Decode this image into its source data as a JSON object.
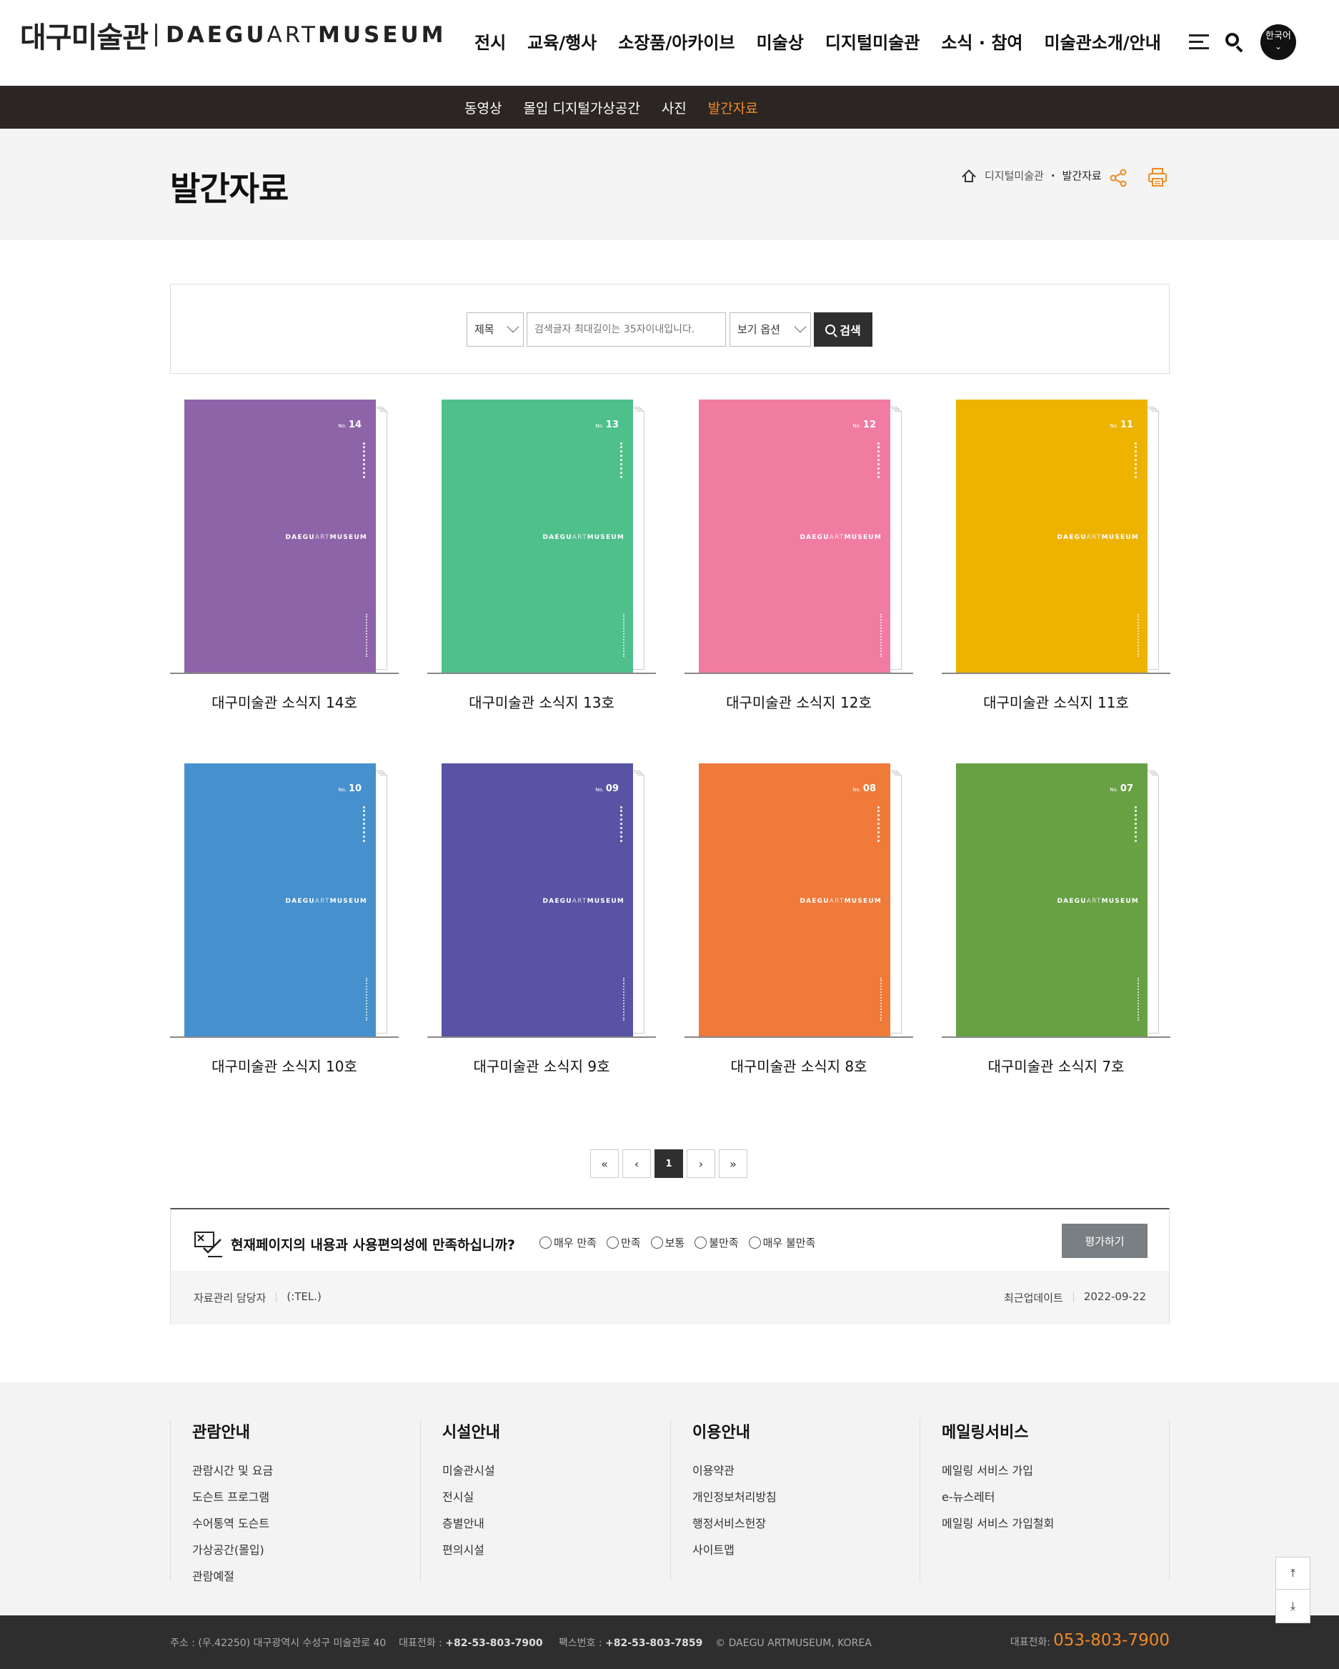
{
  "header": {
    "logo_kr": "대구미술관",
    "logo_en_a": "DAEGU",
    "logo_en_b": "ART",
    "logo_en_c": "MUSEUM",
    "nav": [
      "전시",
      "교육/행사",
      "소장품/아카이브",
      "미술상",
      "디지털미술관",
      "소식 · 참여",
      "미술관소개/안내"
    ],
    "lang": "한국어"
  },
  "subnav": {
    "items": [
      "동영상",
      "몰입 디지털가상공간",
      "사진",
      "발간자료"
    ],
    "active_index": 3,
    "active_color": "#f08a24"
  },
  "page": {
    "title": "발간자료",
    "breadcrumb": [
      "디지털미술관",
      "발간자료"
    ]
  },
  "search": {
    "field_select": "제목",
    "placeholder": "검색글자 최대길이는 35자이내입니다.",
    "view_select": "보기 옵션",
    "button": "검색"
  },
  "books": [
    {
      "title": "대구미술관 소식지 14호",
      "no": "14",
      "color": "#8e64a8"
    },
    {
      "title": "대구미술관 소식지 13호",
      "no": "13",
      "color": "#4fbf8c"
    },
    {
      "title": "대구미술관 소식지 12호",
      "no": "12",
      "color": "#f17ca2"
    },
    {
      "title": "대구미술관 소식지 11호",
      "no": "11",
      "color": "#eeb200"
    },
    {
      "title": "대구미술관 소식지 10호",
      "no": "10",
      "color": "#4590cd"
    },
    {
      "title": "대구미술관 소식지 9호",
      "no": "09",
      "color": "#5853a4"
    },
    {
      "title": "대구미술관 소식지 8호",
      "no": "08",
      "color": "#ef7a3a"
    },
    {
      "title": "대구미술관 소식지 7호",
      "no": "07",
      "color": "#67a143"
    }
  ],
  "book_brand": {
    "a": "DAEGU",
    "b": "ART",
    "c": "MUSEUM",
    "no_prefix": "No."
  },
  "pagination": {
    "current": "1"
  },
  "survey": {
    "question": "현재페이지의 내용과 사용편의성에 만족하십니까?",
    "options": [
      "매우 만족",
      "만족",
      "보통",
      "불만족",
      "매우 불만족"
    ],
    "button": "평가하기",
    "manager_label": "자료관리 담당자",
    "tel": "(:TEL.)",
    "updated_label": "최근업데이트",
    "updated_date": "2022-09-22"
  },
  "footer": {
    "columns": [
      {
        "title": "관람안내",
        "items": [
          "관람시간 및 요금",
          "도슨트 프로그램",
          "수어통역 도슨트",
          "가상공간(몰입)",
          "관람예절"
        ]
      },
      {
        "title": "시설안내",
        "items": [
          "미술관시설",
          "전시실",
          "층별안내",
          "편의시설"
        ]
      },
      {
        "title": "이용안내",
        "items": [
          "이용약관",
          "개인정보처리방침",
          "행정서비스헌장",
          "사이트맵"
        ]
      },
      {
        "title": "메일링서비스",
        "items": [
          "메일링 서비스 가입",
          "e-뉴스레터",
          "메일링 서비스 가입철회"
        ]
      }
    ],
    "address": "주소 : (우.42250) 대구광역시 수성구 미술관로 40",
    "rep_tel_label": "대표전화 :",
    "rep_tel": "+82-53-803-7900",
    "fax_label": "팩스번호 :",
    "fax": "+82-53-803-7859",
    "copyright": "© DAEGU ARTMUSEUM, KOREA",
    "tel_label": "대표전화:",
    "tel_big": "053-803-7900"
  }
}
